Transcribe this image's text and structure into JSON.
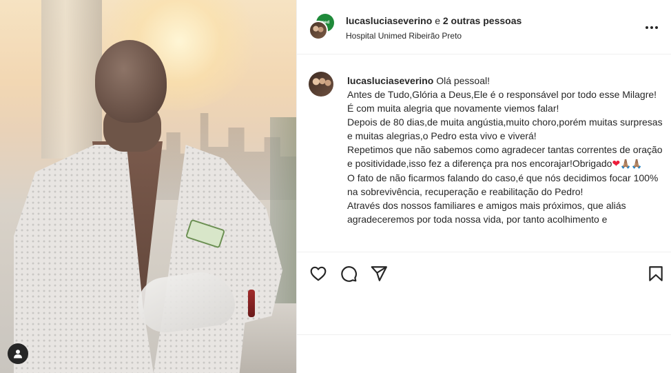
{
  "header": {
    "username": "lucasluciaseverino",
    "conjunction": "e",
    "others": "2 outras pessoas",
    "location": "Hospital Unimed Ribeirão Preto",
    "collab_avatar_text": "med"
  },
  "caption": {
    "username": "lucasluciaseverino",
    "lines": [
      "Olá pessoal!",
      "Antes de Tudo,Glória a Deus,Ele é o responsável por todo esse Milagre!",
      "É com muita alegria que novamente viemos falar!",
      "Depois de 80 dias,de muita angústia,muito choro,porém muitas surpresas e muitas alegrias,o Pedro esta vivo e viverá!",
      "Repetimos que não sabemos como agradecer tantas correntes de oração e positividade,isso fez a diferença pra nos encorajar!Obrigado",
      "O fato de não ficarmos falando do caso,é que nós decidimos focar 100% na sobrevivência, recuperação e reabilitação do Pedro!",
      "Através dos nossos familiares e amigos mais próximos, que aliás agradeceremos por toda nossa vida, por tanto acolhimento e"
    ],
    "emoji_heart": "❤",
    "emoji_hands": "🙏🏽🙏🏽"
  },
  "icons": {
    "like": "heart-outline-icon",
    "comment": "comment-icon",
    "share": "paper-plane-icon",
    "save": "bookmark-icon",
    "more": "more-horizontal-icon",
    "tagged_user": "user-tag-icon"
  },
  "colors": {
    "text": "#262626",
    "divider": "#efefef",
    "heart": "#ed1c3a"
  }
}
